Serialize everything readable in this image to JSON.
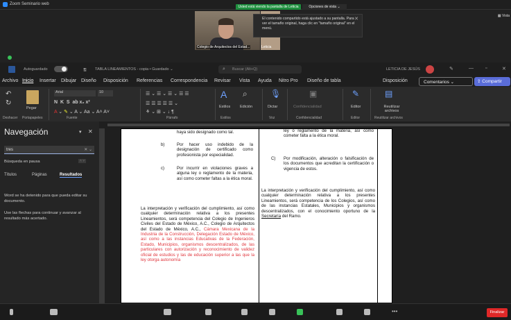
{
  "zoom": {
    "title": "Zoom Seminario web",
    "share_banner": "Usted está viendo la pantalla de Leticia",
    "view_options": "Opciones de vista ⌄",
    "tooltip": "El contenido compartido está ajustado a su pantalla. Para ver el tamaño original, haga clic en \"tamaño original\" en el menú.",
    "video_label": "Colegio de Arquitectos del Estad...",
    "video2_label": "Leticia",
    "view_btn": "▦ Vista",
    "finish": "Finalizar"
  },
  "word": {
    "autosave": "Autoguardado",
    "doc_title": "TABLA LINEAMIENTOS - copia • Guardado ⌄",
    "search_placeholder": "Buscar (Alt+Q)",
    "user": "LETICIA DE JESÚS",
    "menu": [
      "Archivo",
      "Inicio",
      "Insertar",
      "Dibujar",
      "Diseño",
      "Disposición",
      "Referencias",
      "Correspondencia",
      "Revisar",
      "Vista",
      "Ayuda",
      "Nitro Pro",
      "Diseño de tabla",
      "Disposición"
    ],
    "comments": "Comentarios ⌄",
    "share": "Compartir",
    "ribbon": {
      "font": "Arial",
      "size": "10",
      "pegar": "Pegar",
      "estilos": "Estilos",
      "edicion": "Edición",
      "dictar": "Dictar",
      "confidencialidad": "Confidencialidad",
      "editor": "Editor",
      "reutilizar": "Reutilizar archivos",
      "labels": [
        "Deshacer",
        "Portapapeles",
        "Fuente",
        "Párrafo",
        "Estilos",
        "Voz",
        "Confidencialidad",
        "Editor",
        "Reutilizar archivos"
      ]
    }
  },
  "nav": {
    "title": "Navegación",
    "search": "tres",
    "status": "Búsqueda en pausa",
    "tabs": [
      "Títulos",
      "Páginas",
      "Resultados"
    ],
    "msg1": "Word se ha detenido para que pueda editar su documento.",
    "msg2": "Use las flechas para continuar y avanzar al resultado más acertado."
  },
  "doc": {
    "l_top": "haya sido designado como tal.",
    "l_b_key": "b)",
    "l_b": "Por hacer uso indebido de la designación de certificado como profesionista por especialidad.",
    "l_c_key": "c)",
    "l_c": "Por incurrir en violaciones graves a alguna ley o reglamento de la materia, así como cometer faltas a la ética moral.",
    "l_p1": "La interpretación y verificación del cumplimiento, así como cualquier determinación relativa a los presentes Lineamientos, será competencia del Colegio de Ingenieros Civiles del Estado de México, A.C., Colegio de Arquitectos del Estado de México, A.C.,",
    "l_p1_red": "Cámara Mexicana de la Industria de la Construcción, Delegación Estado de México, así como a las instancias Educativas de la Federación, Estado, Municipios, organismos descentralizados, de las particulares con autorización y reconocimiento de validez oficial de estudios y las de educación superior a las que la ley otorga autonomía",
    "r_top": "ley o reglamento de la materia, así como cometer falta a la ética moral.",
    "r_c_key": "C)",
    "r_c": "Por modificación, alteración o falsificación de los documentos que acreditan la certificación o vigencia de estos.",
    "r_p1": "La interpretación y verificación del cumplimiento, así como cualquier determinación relativa a los presentes Lineamientos, será competencia de los Colegios, así como de las instancias Estatales, Municipios y organismos descentralizados, con el conocimiento oportuno de la",
    "r_p1_link": "Secretaría",
    "r_p1_end": "del Ramo."
  }
}
